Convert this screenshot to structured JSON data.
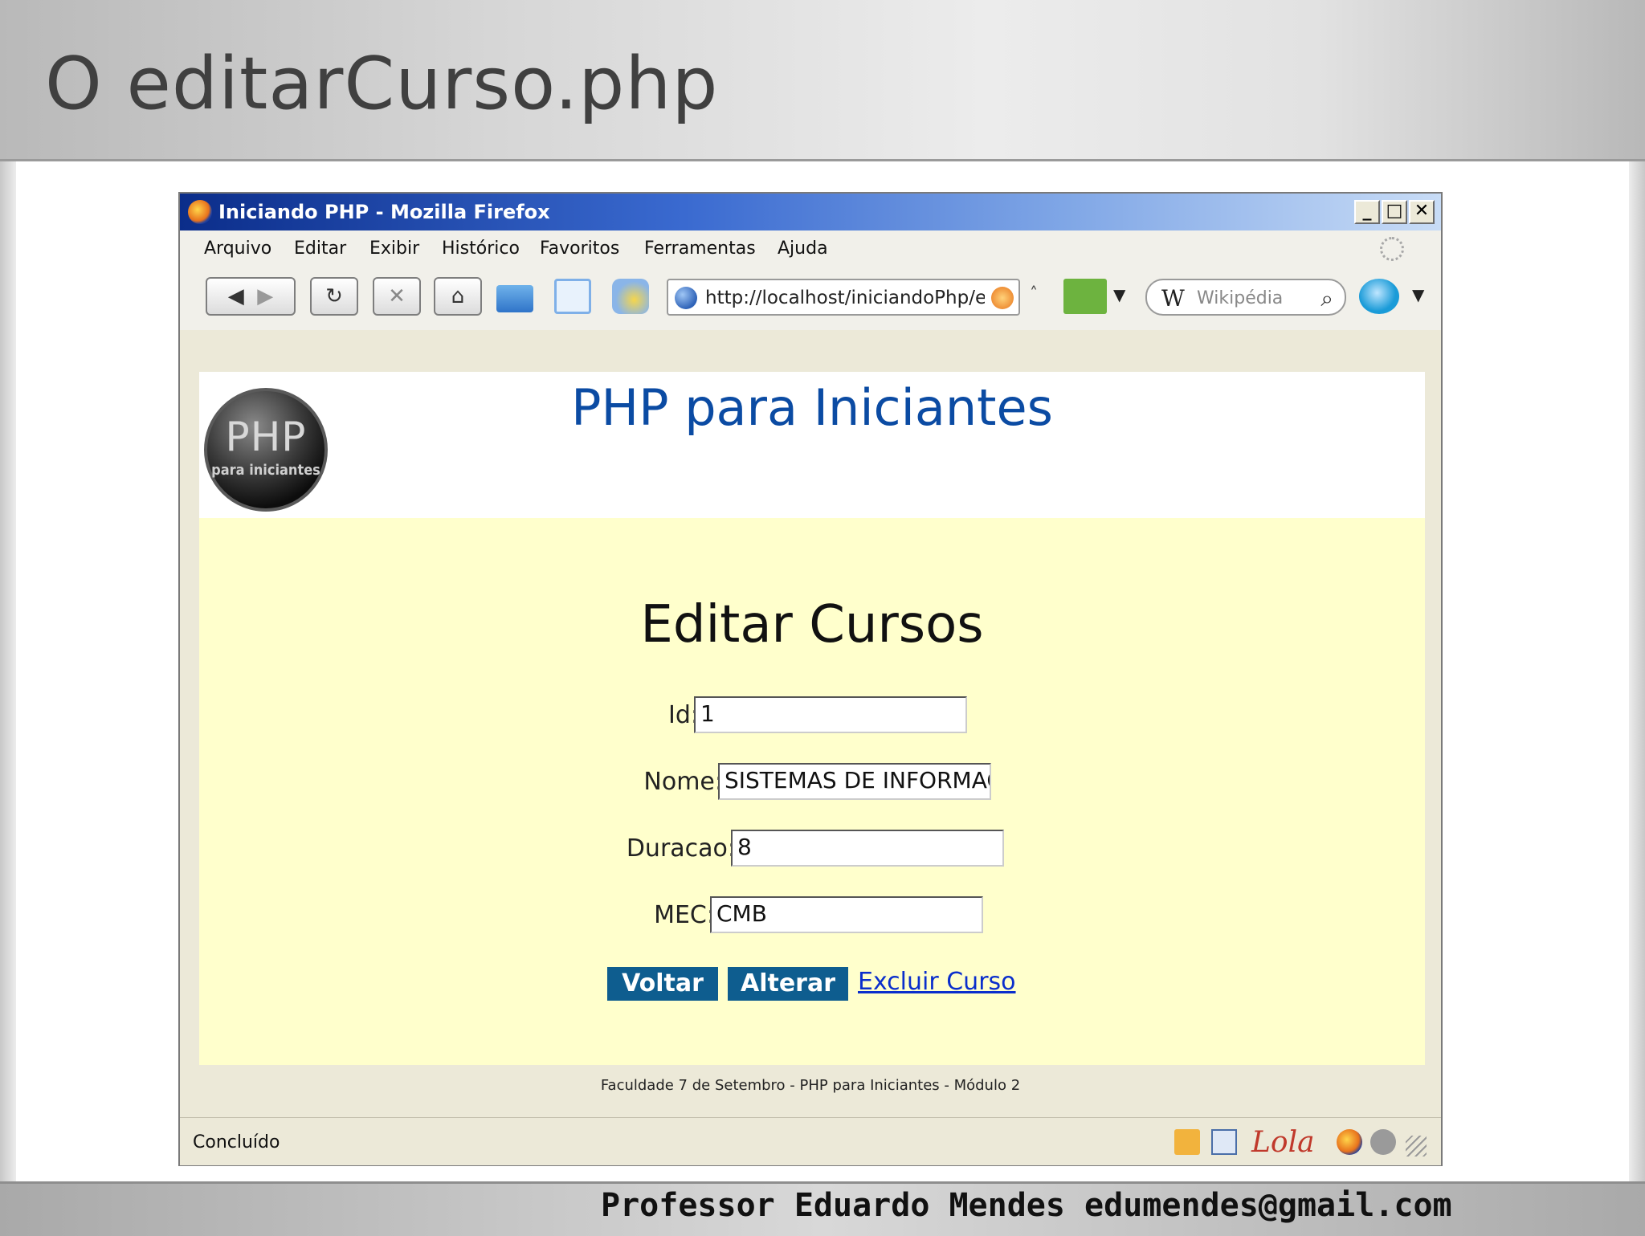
{
  "slide": {
    "title": "O editarCurso.php",
    "footer": "Professor Eduardo Mendes edumendes@gmail.com"
  },
  "browser": {
    "title": "Iniciando PHP - Mozilla Firefox",
    "window_buttons": {
      "minimize": "_",
      "maximize": "□",
      "close": "✕"
    },
    "menu": [
      "Arquivo",
      "Editar",
      "Exibir",
      "Histórico",
      "Favoritos",
      "Ferramentas",
      "Ajuda"
    ],
    "url": "http://localhost/iniciandoPhp/editarCurso.php",
    "search_engine": "W",
    "search_placeholder": "Wikipédia",
    "status": "Concluído",
    "status_logo": "Lola"
  },
  "page": {
    "logo_big": "PHP",
    "logo_small": "para iniciantes",
    "site_title": "PHP para Iniciantes",
    "form_title": "Editar Cursos",
    "fields": {
      "id": {
        "label": "Id:",
        "value": "1"
      },
      "nome": {
        "label": "Nome:",
        "value": "SISTEMAS DE INFORMAÇÃO"
      },
      "duracao": {
        "label": "Duracao:",
        "value": "8"
      },
      "mec": {
        "label": "MEC:",
        "value": "CMB"
      }
    },
    "buttons": {
      "voltar": "Voltar",
      "alterar": "Alterar"
    },
    "link_excluir": "Excluir Curso",
    "footer": "Faculdade 7 de Setembro - PHP para Iniciantes - Módulo 2"
  },
  "colors": {
    "site_title": "#0b4ba3",
    "content_bg": "#ffffcc",
    "button_bg": "#0e5d8f",
    "link": "#0a2ecc"
  }
}
